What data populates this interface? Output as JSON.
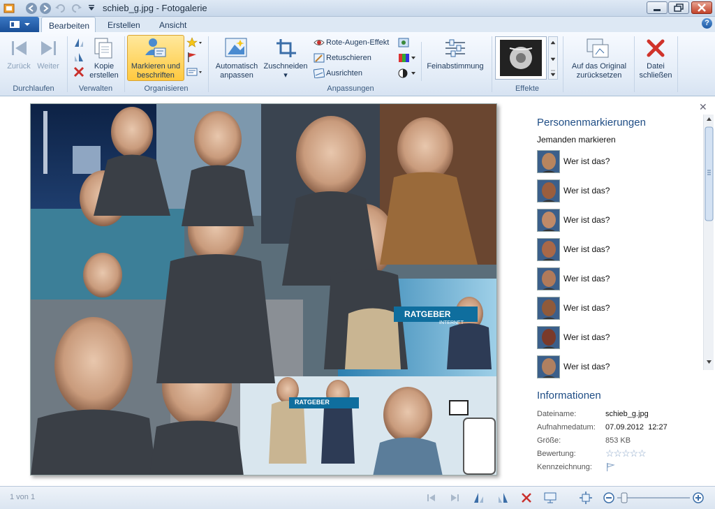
{
  "window": {
    "title": "schieb_g.jpg - Fotogalerie"
  },
  "tabs": [
    {
      "label": "Bearbeiten",
      "active": true
    },
    {
      "label": "Erstellen",
      "active": false
    },
    {
      "label": "Ansicht",
      "active": false
    }
  ],
  "help_label": "?",
  "ribbon": {
    "groups": {
      "durchlaufen": "Durchlaufen",
      "verwalten": "Verwalten",
      "organisieren": "Organisieren",
      "anpassungen": "Anpassungen",
      "effekte": "Effekte"
    },
    "back": "Zurück",
    "forward": "Weiter",
    "copy_line1": "Kopie",
    "copy_line2": "erstellen",
    "tag_line1": "Markieren und",
    "tag_line2": "beschriften",
    "auto_line1": "Automatisch",
    "auto_line2": "anpassen",
    "crop_line1": "Zuschneiden",
    "redeye": "Rote-Augen-Effekt",
    "retouch": "Retuschieren",
    "straighten": "Ausrichten",
    "finetune": "Feinabstimmung",
    "revert_line1": "Auf das Original",
    "revert_line2": "zurücksetzen",
    "close_line1": "Datei",
    "close_line2": "schließen"
  },
  "pane": {
    "people_title": "Personenmarkierungen",
    "tag_someone": "Jemanden markieren",
    "people": [
      {
        "label": "Wer ist das?"
      },
      {
        "label": "Wer ist das?"
      },
      {
        "label": "Wer ist das?"
      },
      {
        "label": "Wer ist das?"
      },
      {
        "label": "Wer ist das?"
      },
      {
        "label": "Wer ist das?"
      },
      {
        "label": "Wer ist das?"
      },
      {
        "label": "Wer ist das?"
      }
    ],
    "info_title": "Informationen",
    "info": {
      "filename_label": "Dateiname:",
      "filename": "schieb_g.jpg",
      "date_label": "Aufnahmedatum:",
      "date": "07.09.2012  12:27",
      "size_label": "Größe:",
      "size": "853 KB",
      "rating_label": "Bewertung:",
      "rating_stars": "☆☆☆☆☆",
      "flag_label": "Kennzeichnung:"
    }
  },
  "photo_overlay": {
    "sign1": "RATGEBER",
    "sign1_sub": "INTERNET",
    "sign2": "RATGEBER"
  },
  "status": {
    "page": "1 von 1"
  },
  "zoom": {
    "level": 0.08
  }
}
